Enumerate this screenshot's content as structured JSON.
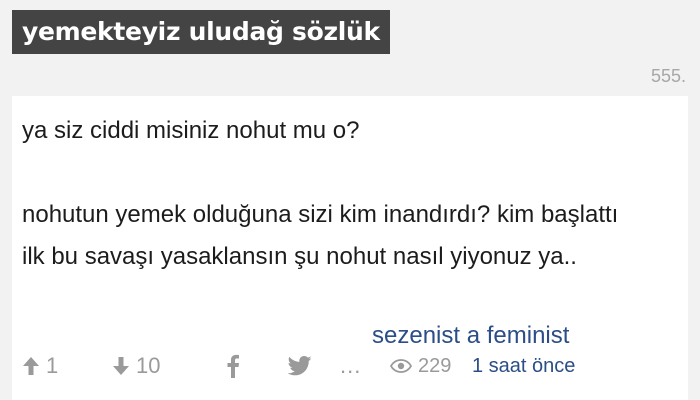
{
  "header": {
    "title": "yemekteyiz uludağ sözlük"
  },
  "entry": {
    "number": "555.",
    "paragraphs": [
      "ya siz ciddi misiniz nohut mu o?",
      "nohutun yemek olduğuna sizi kim inandırdı? kim başlattı ilk bu savaşı yasaklansın şu nohut nasıl yiyonuz ya.."
    ],
    "author": "sezenist a feminist",
    "upvotes": "1",
    "downvotes": "10",
    "more_label": "...",
    "views": "229",
    "timestamp": "1 saat önce"
  },
  "icons": {
    "upvote": "arrow-up-icon",
    "downvote": "arrow-down-icon",
    "facebook": "facebook-icon",
    "twitter": "twitter-icon",
    "views": "eye-icon"
  },
  "colors": {
    "title_bg": "#444444",
    "link": "#2b4e86",
    "muted": "#9a9a9a",
    "background": "#f2f2f2"
  }
}
